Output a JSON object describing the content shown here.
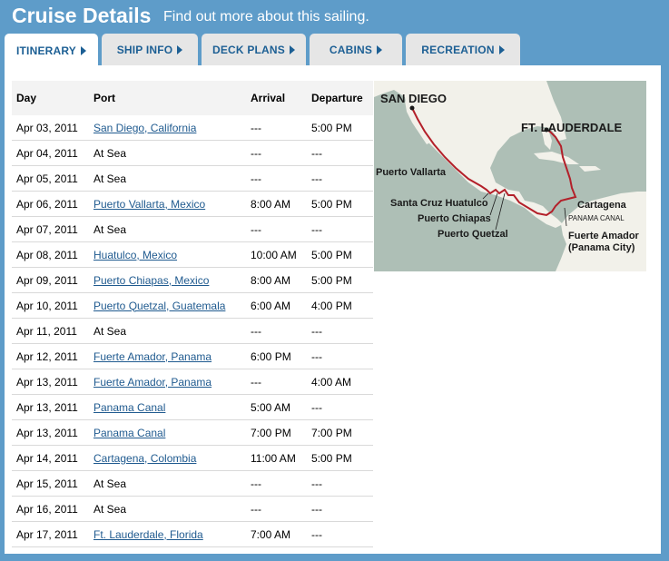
{
  "header": {
    "title": "Cruise Details",
    "subtitle": "Find out more about this sailing."
  },
  "tabs": [
    {
      "label": "ITINERARY",
      "active": true
    },
    {
      "label": "SHIP INFO",
      "active": false
    },
    {
      "label": "DECK PLANS",
      "active": false
    },
    {
      "label": "CABINS",
      "active": false
    },
    {
      "label": "RECREATION",
      "active": false
    }
  ],
  "table": {
    "headers": [
      "Day",
      "Port",
      "Arrival",
      "Departure"
    ],
    "rows": [
      {
        "day": "Apr 03, 2011",
        "port": "San Diego, California",
        "link": true,
        "arrival": "---",
        "departure": "5:00 PM"
      },
      {
        "day": "Apr 04, 2011",
        "port": "At Sea",
        "link": false,
        "arrival": "---",
        "departure": "---"
      },
      {
        "day": "Apr 05, 2011",
        "port": "At Sea",
        "link": false,
        "arrival": "---",
        "departure": "---"
      },
      {
        "day": "Apr 06, 2011",
        "port": "Puerto Vallarta, Mexico",
        "link": true,
        "arrival": "8:00 AM",
        "departure": "5:00 PM"
      },
      {
        "day": "Apr 07, 2011",
        "port": "At Sea",
        "link": false,
        "arrival": "---",
        "departure": "---"
      },
      {
        "day": "Apr 08, 2011",
        "port": "Huatulco, Mexico",
        "link": true,
        "arrival": "10:00 AM",
        "departure": "5:00 PM"
      },
      {
        "day": "Apr 09, 2011",
        "port": "Puerto Chiapas, Mexico",
        "link": true,
        "arrival": "8:00 AM",
        "departure": "5:00 PM"
      },
      {
        "day": "Apr 10, 2011",
        "port": "Puerto Quetzal, Guatemala",
        "link": true,
        "arrival": "6:00 AM",
        "departure": "4:00 PM"
      },
      {
        "day": "Apr 11, 2011",
        "port": "At Sea",
        "link": false,
        "arrival": "---",
        "departure": "---"
      },
      {
        "day": "Apr 12, 2011",
        "port": "Fuerte Amador, Panama",
        "link": true,
        "arrival": "6:00 PM",
        "departure": "---"
      },
      {
        "day": "Apr 13, 2011",
        "port": "Fuerte Amador, Panama",
        "link": true,
        "arrival": "---",
        "departure": "4:00 AM"
      },
      {
        "day": "Apr 13, 2011",
        "port": "Panama Canal",
        "link": true,
        "arrival": "5:00 AM",
        "departure": "---"
      },
      {
        "day": "Apr 13, 2011",
        "port": "Panama Canal",
        "link": true,
        "arrival": "7:00 PM",
        "departure": "7:00 PM"
      },
      {
        "day": "Apr 14, 2011",
        "port": "Cartagena, Colombia",
        "link": true,
        "arrival": "11:00 AM",
        "departure": "5:00 PM"
      },
      {
        "day": "Apr 15, 2011",
        "port": "At Sea",
        "link": false,
        "arrival": "---",
        "departure": "---"
      },
      {
        "day": "Apr 16, 2011",
        "port": "At Sea",
        "link": false,
        "arrival": "---",
        "departure": "---"
      },
      {
        "day": "Apr 17, 2011",
        "port": "Ft. Lauderdale, Florida",
        "link": true,
        "arrival": "7:00 AM",
        "departure": "---"
      }
    ]
  },
  "map": {
    "labels": {
      "san_diego": "SAN DIEGO",
      "ft_lauderdale": "FT. LAUDERDALE",
      "puerto_vallarta": "Puerto Vallarta",
      "santa_cruz": "Santa Cruz Huatulco",
      "puerto_chiapas": "Puerto Chiapas",
      "puerto_quetzal": "Puerto Quetzal",
      "cartagena": "Cartagena",
      "panama_canal": "PANAMA CANAL",
      "fuerte_amador_1": "Fuerte Amador",
      "fuerte_amador_2": "(Panama City)"
    },
    "colors": {
      "water": "#aebfb6",
      "land": "#f2f1ea",
      "route": "#b3202a"
    }
  }
}
